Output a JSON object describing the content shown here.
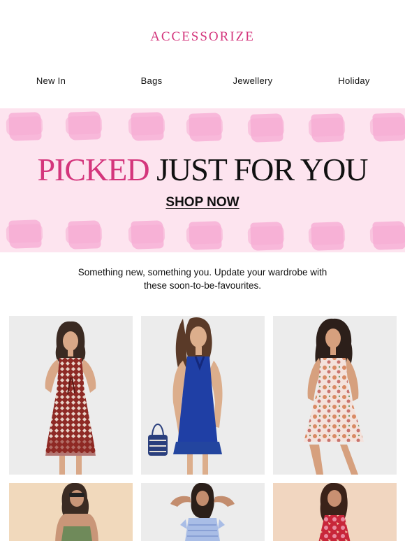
{
  "brand": {
    "logo": "ACCESSORIZE"
  },
  "nav": {
    "items": [
      {
        "label": "New In"
      },
      {
        "label": "Bags"
      },
      {
        "label": "Jewellery"
      },
      {
        "label": "Holiday"
      }
    ]
  },
  "hero": {
    "title_highlight": "PICKED",
    "title_rest": "JUST FOR YOU",
    "cta": "SHOP NOW"
  },
  "intro": {
    "line1": "Something new, something you. Update your wardrobe with",
    "line2": "these soon-to-be-favourites."
  },
  "colors": {
    "brand_pink": "#d4357c",
    "hero_bg": "#fde4ef",
    "hero_blob": "#f8b6d9"
  },
  "products": [
    {
      "icon": "red-print-dress-photo"
    },
    {
      "icon": "blue-dress-photo"
    },
    {
      "icon": "floral-dress-photo"
    },
    {
      "icon": "green-cami-photo"
    },
    {
      "icon": "blue-smocked-top-photo"
    },
    {
      "icon": "red-print-top-photo"
    }
  ]
}
